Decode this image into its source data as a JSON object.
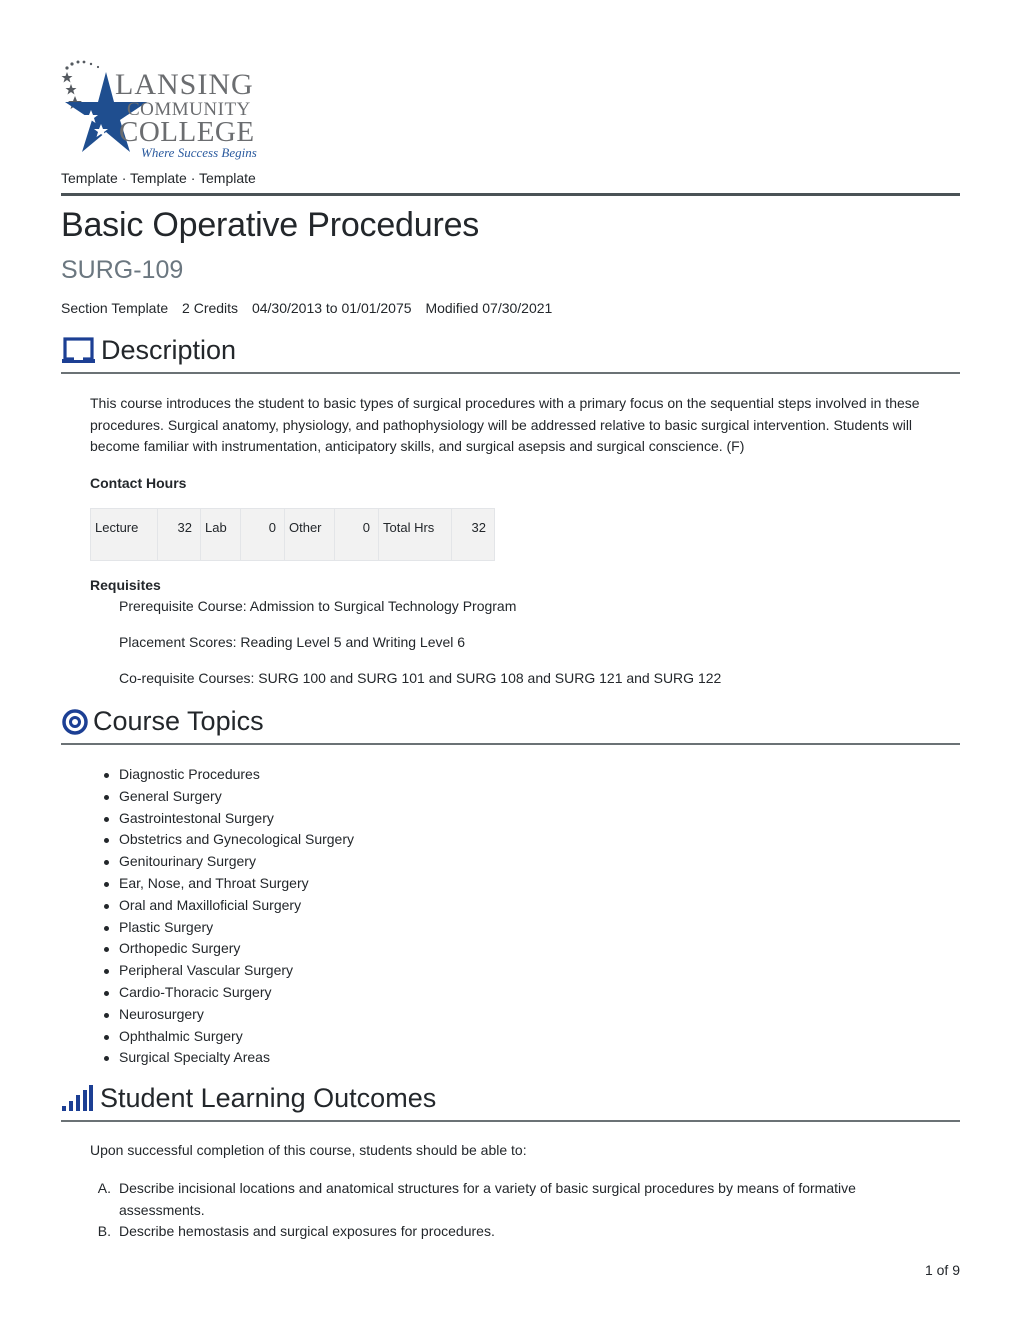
{
  "logo": {
    "line1": "LANSING",
    "line2": "COMMUNITY",
    "line3": "COLLEGE",
    "tagline": "Where Success Begins",
    "brand_blue": "#1f4e8f",
    "brand_gray": "#6b6d70"
  },
  "breadcrumb": "Template · Template · Template",
  "course": {
    "title": "Basic Operative Procedures",
    "code": "SURG-109",
    "meta": {
      "section": "Section Template",
      "credits": "2 Credits",
      "dates": "04/30/2013 to 01/01/2075",
      "modified": "Modified 07/30/2021"
    }
  },
  "sections": {
    "description": {
      "heading": "Description",
      "icon": "laptop-icon",
      "text": "This course introduces the student to basic types of surgical procedures with a primary focus on the sequential steps involved in these procedures. Surgical anatomy, physiology, and pathophysiology will be addressed relative to basic surgical intervention. Students will become familiar with instrumentation, anticipatory skills, and surgical asepsis and surgical conscience. (F)",
      "contact_hours": {
        "label": "Contact Hours",
        "cells": [
          {
            "label": "Lecture",
            "value": "32"
          },
          {
            "label": "Lab",
            "value": "0"
          },
          {
            "label": "Other",
            "value": "0"
          },
          {
            "label": "Total Hrs",
            "value": "32"
          }
        ]
      },
      "requisites": {
        "label": "Requisites",
        "items": [
          "Prerequisite Course: Admission to Surgical Technology Program",
          "Placement Scores: Reading Level 5 and Writing Level 6",
          "Co-requisite Courses: SURG 100 and SURG 101 and SURG 108 and SURG 121 and SURG 122"
        ]
      }
    },
    "topics": {
      "heading": "Course Topics",
      "icon": "target-icon",
      "items": [
        "Diagnostic Procedures",
        "General Surgery",
        "Gastrointestonal Surgery",
        "Obstetrics and Gynecological Surgery",
        "Genitourinary Surgery",
        "Ear, Nose, and Throat Surgery",
        "Oral and Maxilloficial Surgery",
        "Plastic Surgery",
        "Orthopedic Surgery",
        "Peripheral Vascular Surgery",
        "Cardio-Thoracic Surgery",
        "Neurosurgery",
        "Ophthalmic Surgery",
        "Surgical Specialty Areas"
      ]
    },
    "outcomes": {
      "heading": "Student Learning Outcomes",
      "icon": "signal-bars-icon",
      "intro": "Upon successful completion of this course, students should be able to:",
      "items": [
        {
          "marker": "A.",
          "text": "Describe incisional locations and anatomical structures for a variety of basic surgical procedures by means of formative assessments."
        },
        {
          "marker": "B.",
          "text": "Describe hemostasis and surgical exposures for procedures."
        }
      ]
    }
  },
  "colors": {
    "icon_blue": "#1c3f94",
    "rule": "#4a5256",
    "code_gray": "#6b7780",
    "table_bg": "#f2f2f2"
  },
  "pager": "1 of 9"
}
